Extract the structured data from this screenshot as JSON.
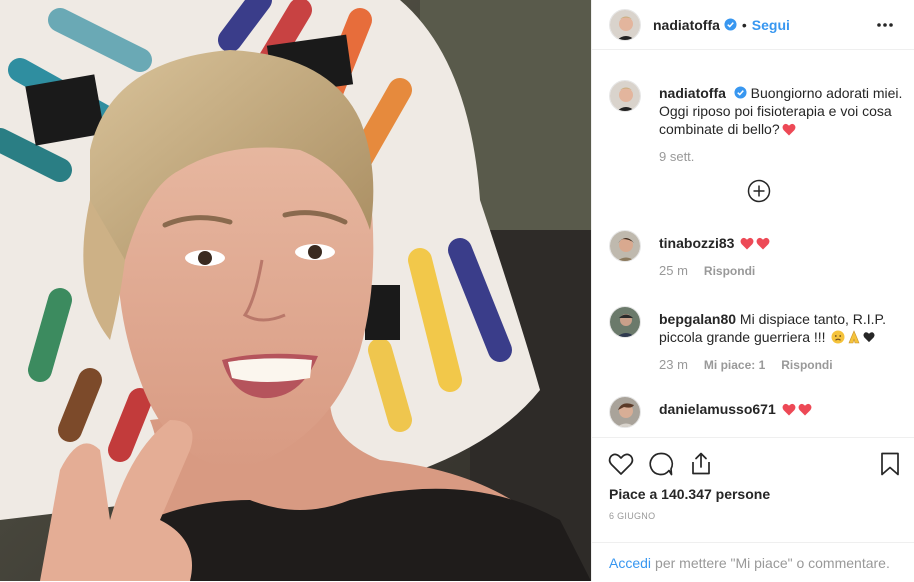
{
  "post": {
    "photo_icon": "selfie-photo",
    "author": {
      "username": "nadiatoffa",
      "verified_icon": "verified-badge-icon",
      "separator": "•",
      "follow_label": "Segui",
      "more_icon": "more-options-icon"
    },
    "caption": {
      "username": "nadiatoffa",
      "text": "Buongiorno adorati miei. Oggi riposo poi fisioterapia e voi cosa combinate di bello?",
      "emoji": "heart-emoji",
      "time": "9 sett."
    },
    "load_more_icon": "plus-circle-icon",
    "comments": [
      {
        "username": "tinabozzi83",
        "text": "",
        "emoji": [
          "heart-emoji",
          "heart-emoji"
        ],
        "time": "25 m",
        "likes": "",
        "reply": "Rispondi"
      },
      {
        "username": "bepgalan80",
        "text": "Mi dispiace tanto, R.I.P. piccola grande guerriera !!!",
        "emoji": [
          "sad-face-emoji",
          "folded-hands-emoji",
          "black-heart-emoji"
        ],
        "time": "23 m",
        "likes": "Mi piace: 1",
        "reply": "Rispondi"
      },
      {
        "username": "danielamusso671",
        "text": "",
        "emoji": [
          "heart-emoji",
          "heart-emoji"
        ],
        "time": "",
        "likes": "",
        "reply": ""
      }
    ],
    "actions": {
      "like_icon": "heart-outline-icon",
      "comment_icon": "comment-icon",
      "share_icon": "share-icon",
      "save_icon": "bookmark-icon"
    },
    "likes_text": "Piace a 140.347 persone",
    "date": "6 GIUGNO",
    "add_comment": {
      "link": "Accedi",
      "text": "per mettere \"Mi piace\" o commentare."
    },
    "colors": {
      "link": "#3897f0",
      "verified": "#3897f0",
      "heart": "#ed4956",
      "text": "#262626",
      "muted": "#999999"
    }
  }
}
